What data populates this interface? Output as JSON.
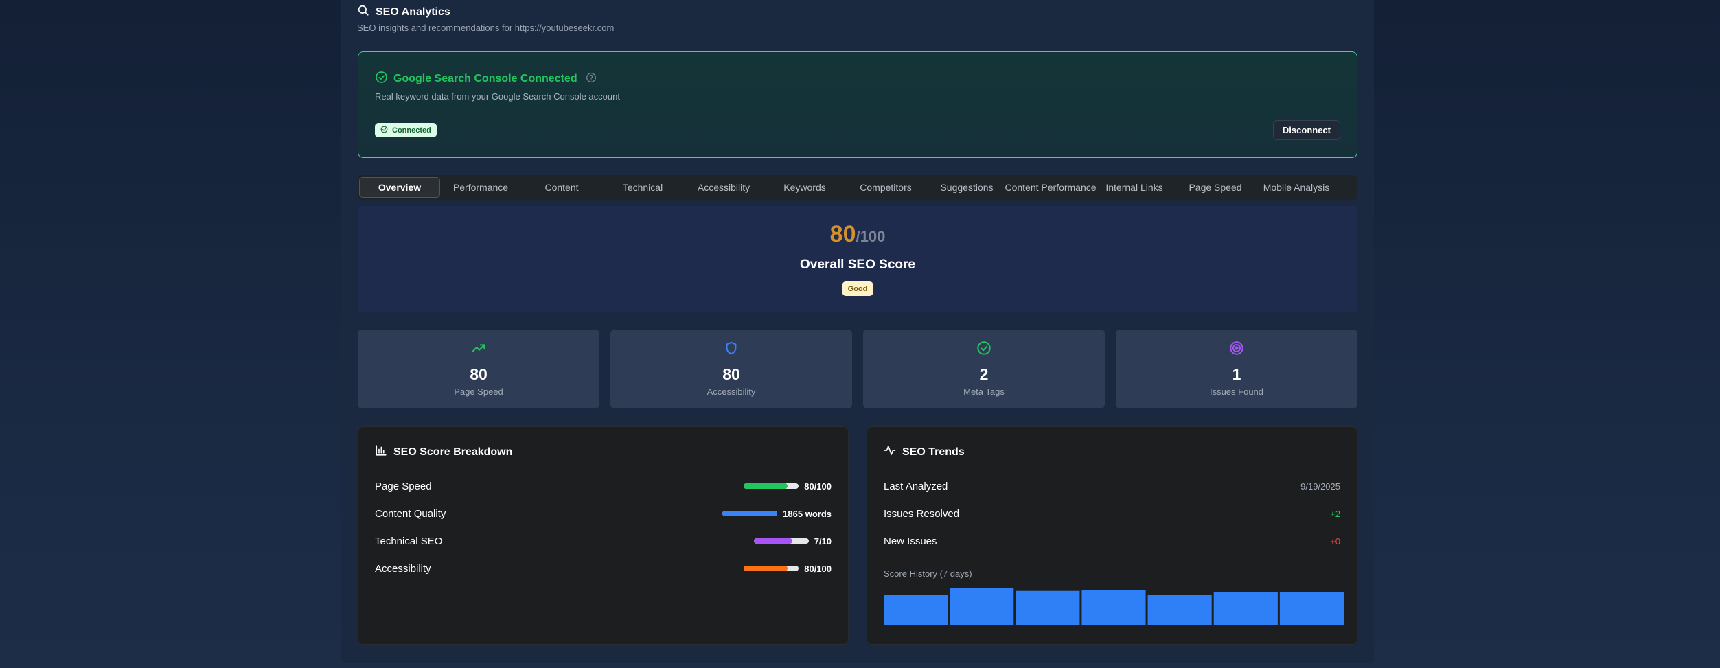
{
  "header": {
    "title": "SEO Analytics",
    "subtitle": "SEO insights and recommendations for https://youtubeseekr.com"
  },
  "gsc": {
    "title": "Google Search Console Connected",
    "description": "Real keyword data from your Google Search Console account",
    "status_badge": "Connected",
    "disconnect_label": "Disconnect"
  },
  "tabs": [
    {
      "label": "Overview",
      "active": true
    },
    {
      "label": "Performance"
    },
    {
      "label": "Content"
    },
    {
      "label": "Technical"
    },
    {
      "label": "Accessibility"
    },
    {
      "label": "Keywords"
    },
    {
      "label": "Competitors"
    },
    {
      "label": "Suggestions"
    },
    {
      "label": "Content Performance"
    },
    {
      "label": "Internal Links"
    },
    {
      "label": "Page Speed"
    },
    {
      "label": "Mobile Analysis"
    }
  ],
  "score": {
    "value": "80",
    "max": "/100",
    "label": "Overall SEO Score",
    "rating": "Good"
  },
  "stats": [
    {
      "value": "80",
      "label": "Page Speed",
      "icon": "trending-up-icon",
      "color": "#22c55e"
    },
    {
      "value": "80",
      "label": "Accessibility",
      "icon": "shield-icon",
      "color": "#3b82f6"
    },
    {
      "value": "2",
      "label": "Meta Tags",
      "icon": "check-circle-icon",
      "color": "#22c55e"
    },
    {
      "value": "1",
      "label": "Issues Found",
      "icon": "target-icon",
      "color": "#a855f7"
    }
  ],
  "breakdown": {
    "title": "SEO Score Breakdown",
    "rows": [
      {
        "label": "Page Speed",
        "value": "80/100",
        "fill": 0.8,
        "color": "#22c55e"
      },
      {
        "label": "Content Quality",
        "value": "1865 words",
        "fill": 1.0,
        "color": "#3b82f6"
      },
      {
        "label": "Technical SEO",
        "value": "7/10",
        "fill": 0.7,
        "color": "#a855f7"
      },
      {
        "label": "Accessibility",
        "value": "80/100",
        "fill": 0.8,
        "color": "#f97316"
      }
    ]
  },
  "trends": {
    "title": "SEO Trends",
    "rows": [
      {
        "label": "Last Analyzed",
        "value": "9/19/2025",
        "color": "#a2aab7"
      },
      {
        "label": "Issues Resolved",
        "value": "+2",
        "color": "#22c55e"
      },
      {
        "label": "New Issues",
        "value": "+0",
        "color": "#ef4444"
      }
    ],
    "history_label": "Score History (7 days)",
    "history_relative": [
      0.78,
      0.96,
      0.88,
      0.91,
      0.77,
      0.84,
      0.84
    ]
  }
}
